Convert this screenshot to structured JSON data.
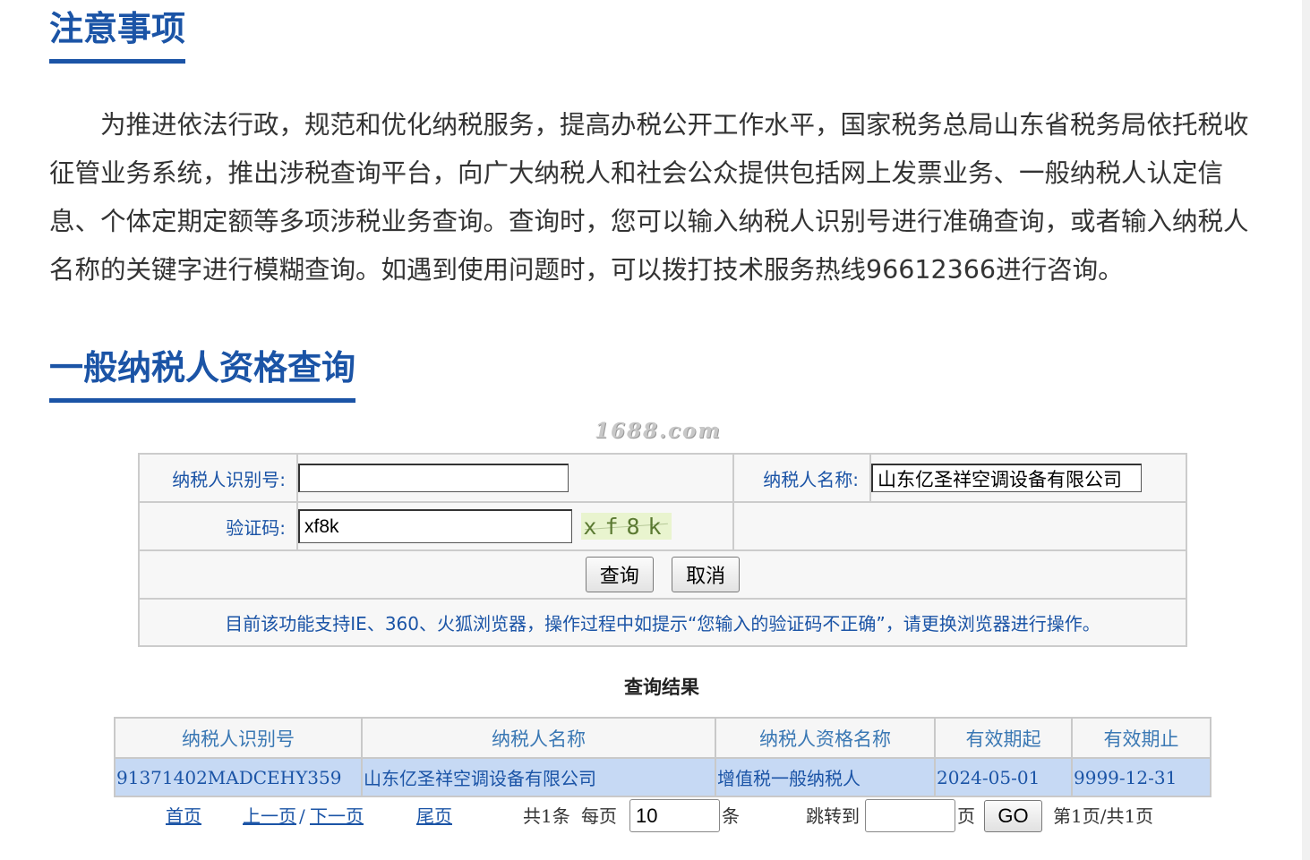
{
  "notice": {
    "title": "注意事项",
    "paragraph": "为推进依法行政，规范和优化纳税服务，提高办税公开工作水平，国家税务总局山东省税务局依托税收征管业务系统，推出涉税查询平台，向广大纳税人和社会公众提供包括网上发票业务、一般纳税人认定信息、个体定期定额等多项涉税业务查询。查询时，您可以输入纳税人识别号进行准确查询，或者输入纳税人名称的关键字进行模糊查询。如遇到使用问题时，可以拨打技术服务热线96612366进行咨询。"
  },
  "query": {
    "title": "一般纳税人资格查询",
    "watermark": "1688.com",
    "form": {
      "taxpayer_id_label": "纳税人识别号:",
      "taxpayer_id_value": "",
      "taxpayer_name_label": "纳税人名称:",
      "taxpayer_name_value": "山东亿圣祥空调设备有限公司",
      "captcha_label": "验证码:",
      "captcha_value": "xf8k",
      "captcha_image_text": "xf8k",
      "submit_label": "查询",
      "cancel_label": "取消",
      "hint": "目前该功能支持IE、360、火狐浏览器，操作过程中如提示“您输入的验证码不正确”，请更换浏览器进行操作。"
    }
  },
  "results": {
    "title": "查询结果",
    "columns": [
      "纳税人识别号",
      "纳税人名称",
      "纳税人资格名称",
      "有效期起",
      "有效期止"
    ],
    "rows": [
      [
        "91371402MADCEHY359",
        "山东亿圣祥空调设备有限公司",
        "增值税一般纳税人",
        "2024-05-01",
        "9999-12-31"
      ]
    ]
  },
  "pager": {
    "first": "首页",
    "prev": "上一页",
    "separator": "/",
    "next": "下一页",
    "last": "尾页",
    "total": "共1条",
    "per_page_label": "每页",
    "per_page_value": "10",
    "per_page_unit": "条",
    "jump_label": "跳转到",
    "jump_value": "",
    "jump_unit": "页",
    "go_label": "GO",
    "status": "第1页/共1页"
  },
  "colors": {
    "accent": "#1b54a6",
    "row_highlight": "#c6d9f4",
    "header_text": "#3a78b4"
  }
}
